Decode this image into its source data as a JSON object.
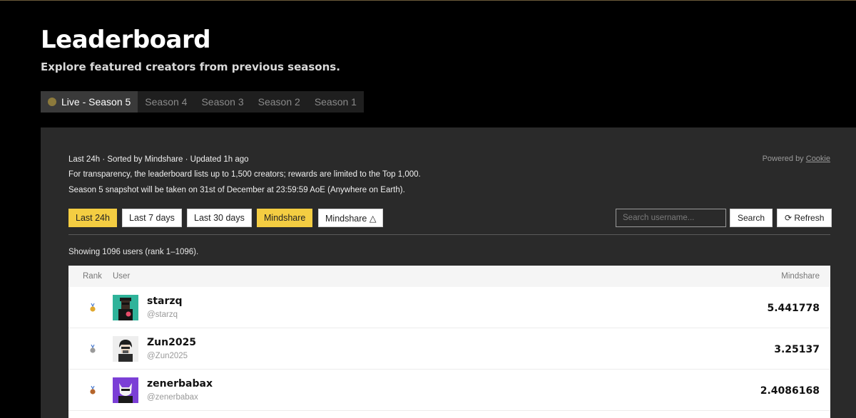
{
  "header": {
    "title": "Leaderboard",
    "subtitle": "Explore featured creators from previous seasons."
  },
  "season_tabs": [
    {
      "label": "Live - Season 5",
      "active": true
    },
    {
      "label": "Season 4",
      "active": false
    },
    {
      "label": "Season 3",
      "active": false
    },
    {
      "label": "Season 2",
      "active": false
    },
    {
      "label": "Season 1",
      "active": false
    }
  ],
  "info": {
    "line1": "Last 24h · Sorted by Mindshare · Updated 1h ago",
    "line2": "For transparency, the leaderboard lists up to 1,500 creators; rewards are limited to the Top 1,000.",
    "line3": "Season 5 snapshot will be taken on 31st of December at 23:59:59 AoE (Anywhere on Earth).",
    "powered_prefix": "Powered by",
    "powered_link": "Cookie"
  },
  "filters": {
    "last_24h": "Last 24h",
    "last_7_days": "Last 7 days",
    "last_30_days": "Last 30 days",
    "mindshare": "Mindshare",
    "mindshare_alt": "Mindshare △"
  },
  "search": {
    "placeholder": "Search username...",
    "button": "Search",
    "refresh": "⟳ Refresh"
  },
  "showing": "Showing 1096 users (rank 1–1096).",
  "table": {
    "headers": {
      "rank": "Rank",
      "user": "User",
      "mindshare": "Mindshare"
    },
    "rows": [
      {
        "name": "starzq",
        "handle": "@starzq",
        "mindshare": "5.441778",
        "medal": "gold"
      },
      {
        "name": "Zun2025",
        "handle": "@Zun2025",
        "mindshare": "3.25137",
        "medal": "silver"
      },
      {
        "name": "zenerbabax",
        "handle": "@zenerbabax",
        "mindshare": "2.4086168",
        "medal": "bronze"
      }
    ]
  },
  "colors": {
    "accent_yellow": "#f4cd42",
    "gold": "#e0a82e",
    "silver": "#9a9a9a",
    "bronze": "#b5652b",
    "panel": "#2a2a2a"
  }
}
